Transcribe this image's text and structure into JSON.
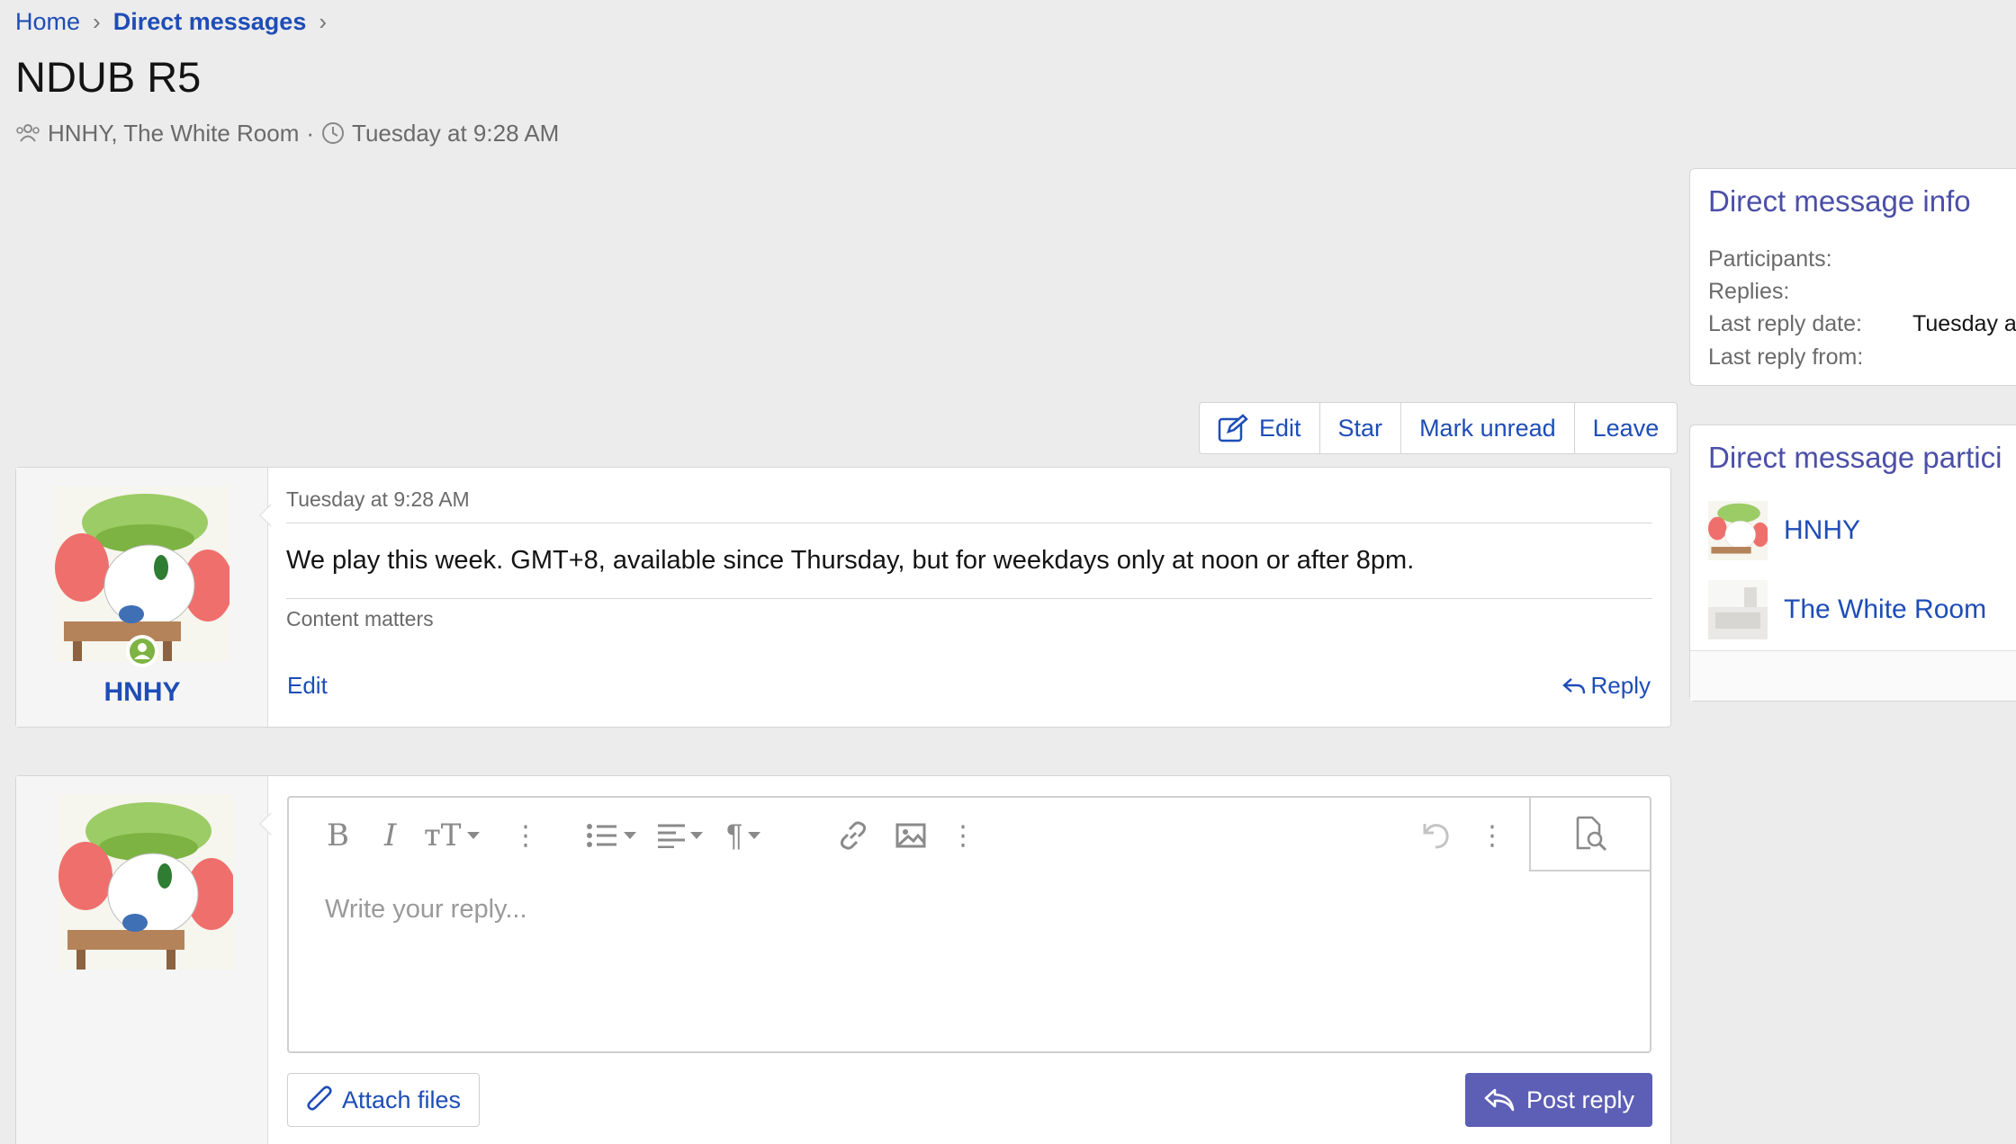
{
  "breadcrumb": {
    "home": "Home",
    "section": "Direct messages"
  },
  "thread": {
    "title": "NDUB R5",
    "participants_line": "HNHY, The White Room",
    "date": "Tuesday at 9:28 AM"
  },
  "actions": {
    "edit": "Edit",
    "star": "Star",
    "mark_unread": "Mark unread",
    "leave": "Leave"
  },
  "message": {
    "author": "HNHY",
    "date": "Tuesday at 9:28 AM",
    "text": "We play this week. GMT+8, available since Thursday, but for weekdays only at noon or after 8pm.",
    "signature": "Content matters",
    "edit_label": "Edit",
    "reply_label": "Reply"
  },
  "editor": {
    "placeholder": "Write your reply...",
    "attach_label": "Attach files",
    "post_label": "Post reply"
  },
  "sidebar": {
    "info": {
      "title": "Direct message info",
      "participants_label": "Participants:",
      "replies_label": "Replies:",
      "last_reply_date_label": "Last reply date:",
      "last_reply_date_value": "Tuesday a",
      "last_reply_from_label": "Last reply from:"
    },
    "participants": {
      "title": "Direct message partici",
      "items": [
        {
          "name": "HNHY"
        },
        {
          "name": "The White Room"
        }
      ]
    }
  },
  "colors": {
    "link": "#1e4db7",
    "primary_button": "#5c5fb5",
    "sidebar_title": "#4b4fa8",
    "online": "#7cb342"
  }
}
